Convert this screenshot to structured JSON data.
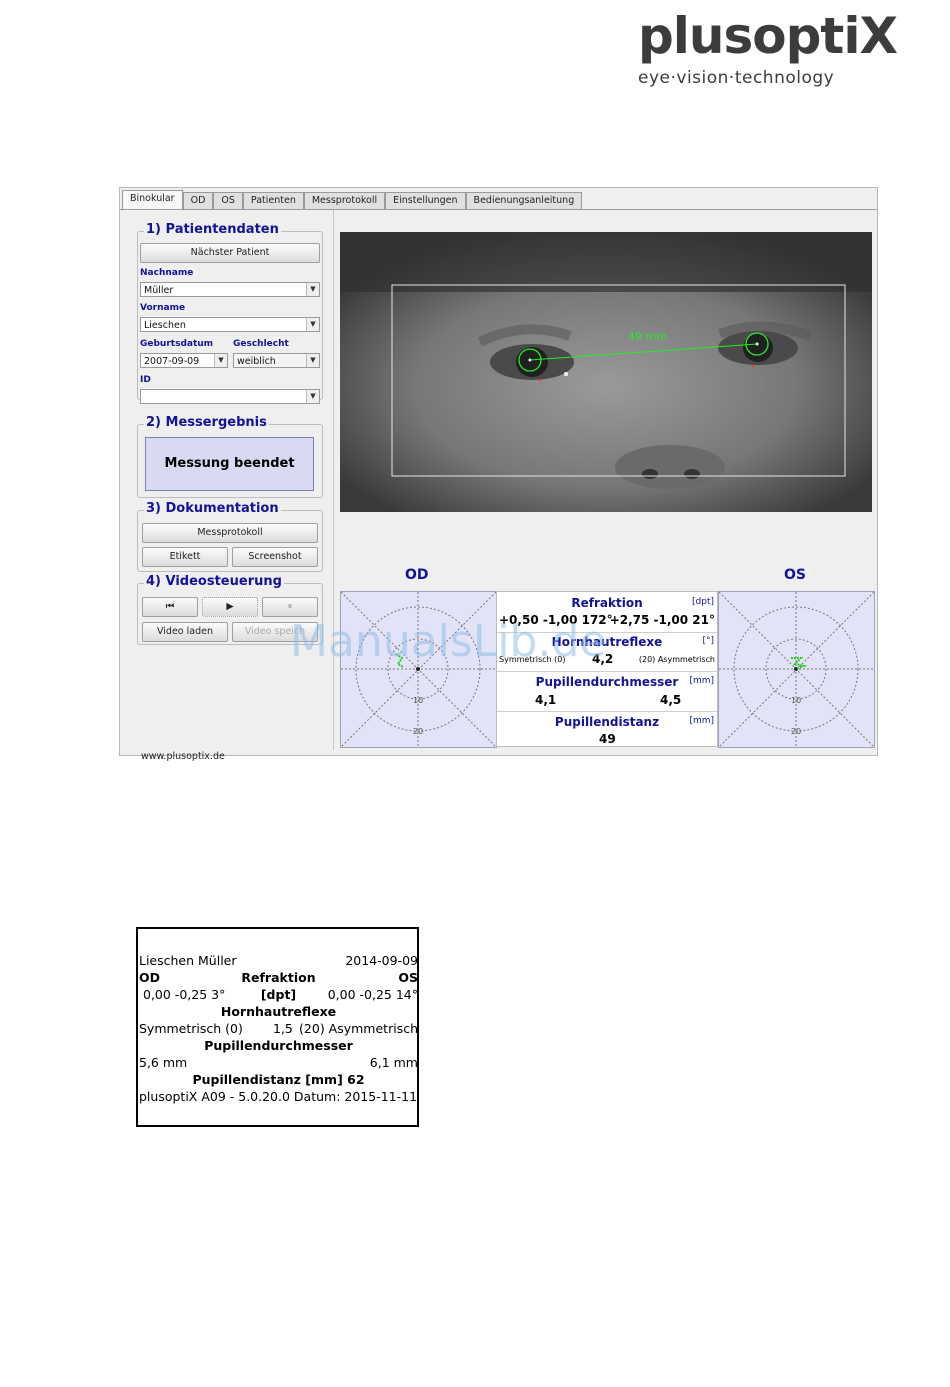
{
  "logo": {
    "brand": "plusoptiX",
    "tagline": "eye·vision·technology"
  },
  "tabs": [
    "Binokular",
    "OD",
    "OS",
    "Patienten",
    "Messprotokoll",
    "Einstellungen",
    "Bedienungsanleitung"
  ],
  "patient": {
    "title": "1) Patientendaten",
    "next_button": "Nächster Patient",
    "lastname_label": "Nachname",
    "lastname": "Müller",
    "firstname_label": "Vorname",
    "firstname": "Lieschen",
    "birthdate_label": "Geburtsdatum",
    "birthdate": "2007-09-09",
    "gender_label": "Geschlecht",
    "gender": "weiblich",
    "id_label": "ID",
    "id": ""
  },
  "result": {
    "title": "2) Messergebnis",
    "status": "Messung beendet"
  },
  "docs": {
    "title": "3) Dokumentation",
    "protocol_button": "Messprotokoll",
    "label_button": "Etikett",
    "screenshot_button": "Screenshot"
  },
  "videoctl": {
    "title": "4) Videosteuerung",
    "rewind_glyph": "⏮",
    "play_glyph": "▶",
    "pause_glyph": "⏸",
    "load_button": "Video laden",
    "save_button": "Video speich"
  },
  "footer_url": "www.plusoptix.de",
  "video": {
    "pd_overlay": "49 mm"
  },
  "od_label": "OD",
  "os_label": "OS",
  "target_ticks": [
    "10",
    "20"
  ],
  "measure": {
    "refraction_title": "Refraktion",
    "refraction_unit": "[dpt]",
    "refraction_od": "+0,50  -1,00 172°",
    "refraction_os": "+2,75  -1,00 21°",
    "cornea_title": "Hornhautreflexe",
    "cornea_unit": "[°]",
    "cornea_left": "Symmetrisch (0)",
    "cornea_value": "4,2",
    "cornea_right": "(20) Asymmetrisch",
    "pupil_title": "Pupillendurchmesser",
    "pupil_unit": "[mm]",
    "pupil_od": "4,1",
    "pupil_os": "4,5",
    "pd_title": "Pupillendistanz",
    "pd_unit": "[mm]",
    "pd_value": "49"
  },
  "watermark": "ManualsLib.de",
  "printout": {
    "name": "Lieschen Müller",
    "date": "2014-09-09",
    "od": "OD",
    "refraction": "Refraktion",
    "os": "OS",
    "ref_od": "0,00  -0,25 3°",
    "unit": "[dpt]",
    "ref_os": "0,00  -0,25 14°",
    "cornea": "Hornhautreflexe",
    "sym": "Symmetrisch (0)",
    "cornea_val": "1,5",
    "asym": "(20) Asymmetrisch",
    "pupil": "Pupillendurchmesser",
    "pupil_od": "5,6 mm",
    "pupil_os": "6,1 mm",
    "pd": "Pupillendistanz [mm] 62",
    "footer": "plusoptiX A09 - 5.0.20.0  Datum: 2015-11-11"
  }
}
